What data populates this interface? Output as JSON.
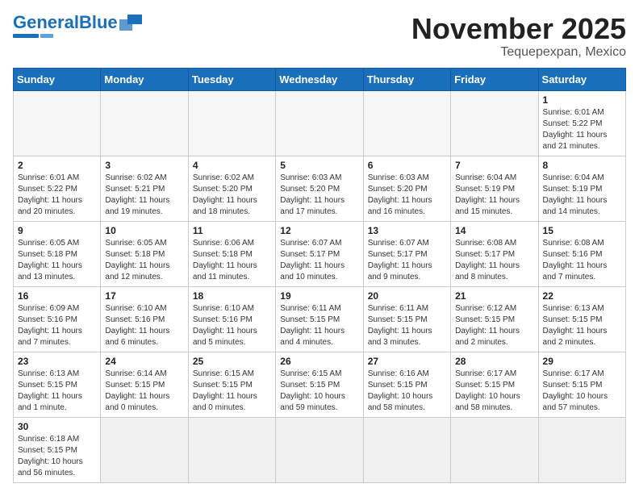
{
  "header": {
    "logo_general": "General",
    "logo_blue": "Blue",
    "month_title": "November 2025",
    "location": "Tequepexpan, Mexico"
  },
  "days_of_week": [
    "Sunday",
    "Monday",
    "Tuesday",
    "Wednesday",
    "Thursday",
    "Friday",
    "Saturday"
  ],
  "weeks": [
    [
      {
        "day": "",
        "info": ""
      },
      {
        "day": "",
        "info": ""
      },
      {
        "day": "",
        "info": ""
      },
      {
        "day": "",
        "info": ""
      },
      {
        "day": "",
        "info": ""
      },
      {
        "day": "",
        "info": ""
      },
      {
        "day": "1",
        "info": "Sunrise: 6:01 AM\nSunset: 5:22 PM\nDaylight: 11 hours and 21 minutes."
      }
    ],
    [
      {
        "day": "2",
        "info": "Sunrise: 6:01 AM\nSunset: 5:22 PM\nDaylight: 11 hours and 20 minutes."
      },
      {
        "day": "3",
        "info": "Sunrise: 6:02 AM\nSunset: 5:21 PM\nDaylight: 11 hours and 19 minutes."
      },
      {
        "day": "4",
        "info": "Sunrise: 6:02 AM\nSunset: 5:20 PM\nDaylight: 11 hours and 18 minutes."
      },
      {
        "day": "5",
        "info": "Sunrise: 6:03 AM\nSunset: 5:20 PM\nDaylight: 11 hours and 17 minutes."
      },
      {
        "day": "6",
        "info": "Sunrise: 6:03 AM\nSunset: 5:20 PM\nDaylight: 11 hours and 16 minutes."
      },
      {
        "day": "7",
        "info": "Sunrise: 6:04 AM\nSunset: 5:19 PM\nDaylight: 11 hours and 15 minutes."
      },
      {
        "day": "8",
        "info": "Sunrise: 6:04 AM\nSunset: 5:19 PM\nDaylight: 11 hours and 14 minutes."
      }
    ],
    [
      {
        "day": "9",
        "info": "Sunrise: 6:05 AM\nSunset: 5:18 PM\nDaylight: 11 hours and 13 minutes."
      },
      {
        "day": "10",
        "info": "Sunrise: 6:05 AM\nSunset: 5:18 PM\nDaylight: 11 hours and 12 minutes."
      },
      {
        "day": "11",
        "info": "Sunrise: 6:06 AM\nSunset: 5:18 PM\nDaylight: 11 hours and 11 minutes."
      },
      {
        "day": "12",
        "info": "Sunrise: 6:07 AM\nSunset: 5:17 PM\nDaylight: 11 hours and 10 minutes."
      },
      {
        "day": "13",
        "info": "Sunrise: 6:07 AM\nSunset: 5:17 PM\nDaylight: 11 hours and 9 minutes."
      },
      {
        "day": "14",
        "info": "Sunrise: 6:08 AM\nSunset: 5:17 PM\nDaylight: 11 hours and 8 minutes."
      },
      {
        "day": "15",
        "info": "Sunrise: 6:08 AM\nSunset: 5:16 PM\nDaylight: 11 hours and 7 minutes."
      }
    ],
    [
      {
        "day": "16",
        "info": "Sunrise: 6:09 AM\nSunset: 5:16 PM\nDaylight: 11 hours and 7 minutes."
      },
      {
        "day": "17",
        "info": "Sunrise: 6:10 AM\nSunset: 5:16 PM\nDaylight: 11 hours and 6 minutes."
      },
      {
        "day": "18",
        "info": "Sunrise: 6:10 AM\nSunset: 5:16 PM\nDaylight: 11 hours and 5 minutes."
      },
      {
        "day": "19",
        "info": "Sunrise: 6:11 AM\nSunset: 5:15 PM\nDaylight: 11 hours and 4 minutes."
      },
      {
        "day": "20",
        "info": "Sunrise: 6:11 AM\nSunset: 5:15 PM\nDaylight: 11 hours and 3 minutes."
      },
      {
        "day": "21",
        "info": "Sunrise: 6:12 AM\nSunset: 5:15 PM\nDaylight: 11 hours and 2 minutes."
      },
      {
        "day": "22",
        "info": "Sunrise: 6:13 AM\nSunset: 5:15 PM\nDaylight: 11 hours and 2 minutes."
      }
    ],
    [
      {
        "day": "23",
        "info": "Sunrise: 6:13 AM\nSunset: 5:15 PM\nDaylight: 11 hours and 1 minute."
      },
      {
        "day": "24",
        "info": "Sunrise: 6:14 AM\nSunset: 5:15 PM\nDaylight: 11 hours and 0 minutes."
      },
      {
        "day": "25",
        "info": "Sunrise: 6:15 AM\nSunset: 5:15 PM\nDaylight: 11 hours and 0 minutes."
      },
      {
        "day": "26",
        "info": "Sunrise: 6:15 AM\nSunset: 5:15 PM\nDaylight: 10 hours and 59 minutes."
      },
      {
        "day": "27",
        "info": "Sunrise: 6:16 AM\nSunset: 5:15 PM\nDaylight: 10 hours and 58 minutes."
      },
      {
        "day": "28",
        "info": "Sunrise: 6:17 AM\nSunset: 5:15 PM\nDaylight: 10 hours and 58 minutes."
      },
      {
        "day": "29",
        "info": "Sunrise: 6:17 AM\nSunset: 5:15 PM\nDaylight: 10 hours and 57 minutes."
      }
    ],
    [
      {
        "day": "30",
        "info": "Sunrise: 6:18 AM\nSunset: 5:15 PM\nDaylight: 10 hours and 56 minutes."
      },
      {
        "day": "",
        "info": ""
      },
      {
        "day": "",
        "info": ""
      },
      {
        "day": "",
        "info": ""
      },
      {
        "day": "",
        "info": ""
      },
      {
        "day": "",
        "info": ""
      },
      {
        "day": "",
        "info": ""
      }
    ]
  ]
}
